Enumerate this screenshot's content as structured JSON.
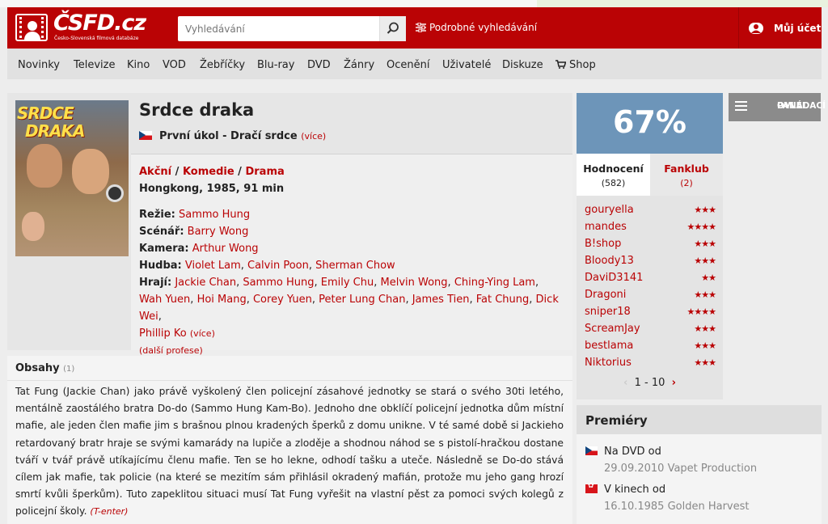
{
  "header": {
    "logo_text": "ČSFD.cz",
    "logo_sub": "Česko-Slovenská filmová databáze",
    "search_placeholder": "Vyhledávání",
    "advanced_search": "Podrobné vyhledávání",
    "account": "Můj účet",
    "brand_color": "#ba0305"
  },
  "nav": [
    "Novinky",
    "Televize",
    "Kino",
    "VOD",
    "Žebříčky",
    "Blu-ray",
    "DVD",
    "Žánry",
    "Ocenění",
    "Uživatelé",
    "Diskuze",
    "Shop"
  ],
  "film": {
    "poster_title_1": "SRDCE",
    "poster_title_2": "DRAKA",
    "title": "Srdce draka",
    "alt_title": "První úkol - Dračí srdce",
    "alt_more": "(více)",
    "genres": [
      "Akční",
      "Komedie",
      "Drama"
    ],
    "origin": "Hongkong, 1985, 91 min",
    "directing_label": "Režie:",
    "directing": "Sammo Hung",
    "writer_label": "Scénář:",
    "writer": "Barry Wong",
    "camera_label": "Kamera:",
    "camera": "Arthur Wong",
    "music_label": "Hudba:",
    "music": [
      "Violet Lam",
      "Calvin Poon",
      "Sherman Chow"
    ],
    "actors_label": "Hrají:",
    "actors": [
      "Jackie Chan",
      "Sammo Hung",
      "Emily Chu",
      "Melvin Wong",
      "Ching-Ying Lam",
      "Wah Yuen",
      "Hoi Mang",
      "Corey Yuen",
      "Peter Lung Chan",
      "James Tien",
      "Fat Chung",
      "Dick Wei",
      "Phillip Ko"
    ],
    "actors_more": "(více)",
    "more_professions": "(další profese)"
  },
  "plot": {
    "heading": "Obsahy",
    "count": "(1)",
    "text": "Tat Fung (Jackie Chan) jako právě vyškolený člen policejní zásahové jednotky se stará o svého 30ti letého, mentálně zaostálého bratra Do-do (Sammo Hung Kam-Bo). Jednoho dne obklíčí policejní jednotka dům místní mafie, ale jeden člen mafie jim s brašnou plnou kradených šperků z domu unikne. V té samé době si Jackieho retardovaný bratr hraje se svými kamarády na lupiče a zloděje a shodnou náhod se s pistolí-hračkou dostane tváří v tvář právě utíkajícímu členu mafie. Ten se ho lekne, odhodí tašku a uteče. Následně se Do-do stává cílem jak mafie, tak policie (na které se mezitím sám přihlásil okradený mafián, protože mu jeho gang hrozí smrtí kvůli šperkům). Tuto zapeklitou situaci musí Tat Fung vyřešit na vlastní pěst za pomoci svých kolegů z policejní školy.",
    "author": "(T-enter)"
  },
  "rating": {
    "percent": "67%",
    "tab_ratings": "Hodnocení",
    "tab_ratings_count": "(582)",
    "tab_fanclub": "Fanklub",
    "tab_fanclub_count": "(2)",
    "box_color": "#6d95b9"
  },
  "user_ratings": [
    {
      "name": "gouryella",
      "stars": "★★★"
    },
    {
      "name": "mandes",
      "stars": "★★★★"
    },
    {
      "name": "B!shop",
      "stars": "★★★"
    },
    {
      "name": "Bloody13",
      "stars": "★★★"
    },
    {
      "name": "DaviD3141",
      "stars": "★★"
    },
    {
      "name": "Dragoni",
      "stars": "★★★"
    },
    {
      "name": "sniper18",
      "stars": "★★★★"
    },
    {
      "name": "ScreamJay",
      "stars": "★★★"
    },
    {
      "name": "bestlama",
      "stars": "★★★"
    },
    {
      "name": "Niktorius",
      "stars": "★★★"
    }
  ],
  "pager": {
    "label": "1 - 10",
    "prev": "‹",
    "next": "›"
  },
  "panel": {
    "label_1": "OVLÁDACÍ",
    "label_2": "PANEL"
  },
  "premieres": {
    "heading": "Premiéry",
    "items": [
      {
        "label": "Na DVD od",
        "detail": "29.09.2010 Vapet Production"
      },
      {
        "label": "V kinech od",
        "detail": "16.10.1985 Golden Harvest"
      }
    ]
  }
}
